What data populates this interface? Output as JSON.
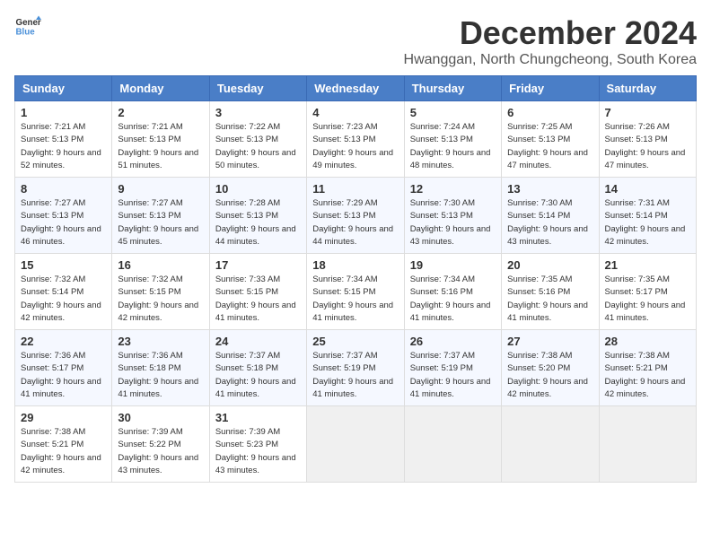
{
  "header": {
    "logo_line1": "General",
    "logo_line2": "Blue",
    "month_title": "December 2024",
    "location": "Hwanggan, North Chungcheong, South Korea"
  },
  "weekdays": [
    "Sunday",
    "Monday",
    "Tuesday",
    "Wednesday",
    "Thursday",
    "Friday",
    "Saturday"
  ],
  "weeks": [
    [
      {
        "day": "1",
        "sunrise": "Sunrise: 7:21 AM",
        "sunset": "Sunset: 5:13 PM",
        "daylight": "Daylight: 9 hours and 52 minutes."
      },
      {
        "day": "2",
        "sunrise": "Sunrise: 7:21 AM",
        "sunset": "Sunset: 5:13 PM",
        "daylight": "Daylight: 9 hours and 51 minutes."
      },
      {
        "day": "3",
        "sunrise": "Sunrise: 7:22 AM",
        "sunset": "Sunset: 5:13 PM",
        "daylight": "Daylight: 9 hours and 50 minutes."
      },
      {
        "day": "4",
        "sunrise": "Sunrise: 7:23 AM",
        "sunset": "Sunset: 5:13 PM",
        "daylight": "Daylight: 9 hours and 49 minutes."
      },
      {
        "day": "5",
        "sunrise": "Sunrise: 7:24 AM",
        "sunset": "Sunset: 5:13 PM",
        "daylight": "Daylight: 9 hours and 48 minutes."
      },
      {
        "day": "6",
        "sunrise": "Sunrise: 7:25 AM",
        "sunset": "Sunset: 5:13 PM",
        "daylight": "Daylight: 9 hours and 47 minutes."
      },
      {
        "day": "7",
        "sunrise": "Sunrise: 7:26 AM",
        "sunset": "Sunset: 5:13 PM",
        "daylight": "Daylight: 9 hours and 47 minutes."
      }
    ],
    [
      {
        "day": "8",
        "sunrise": "Sunrise: 7:27 AM",
        "sunset": "Sunset: 5:13 PM",
        "daylight": "Daylight: 9 hours and 46 minutes."
      },
      {
        "day": "9",
        "sunrise": "Sunrise: 7:27 AM",
        "sunset": "Sunset: 5:13 PM",
        "daylight": "Daylight: 9 hours and 45 minutes."
      },
      {
        "day": "10",
        "sunrise": "Sunrise: 7:28 AM",
        "sunset": "Sunset: 5:13 PM",
        "daylight": "Daylight: 9 hours and 44 minutes."
      },
      {
        "day": "11",
        "sunrise": "Sunrise: 7:29 AM",
        "sunset": "Sunset: 5:13 PM",
        "daylight": "Daylight: 9 hours and 44 minutes."
      },
      {
        "day": "12",
        "sunrise": "Sunrise: 7:30 AM",
        "sunset": "Sunset: 5:13 PM",
        "daylight": "Daylight: 9 hours and 43 minutes."
      },
      {
        "day": "13",
        "sunrise": "Sunrise: 7:30 AM",
        "sunset": "Sunset: 5:14 PM",
        "daylight": "Daylight: 9 hours and 43 minutes."
      },
      {
        "day": "14",
        "sunrise": "Sunrise: 7:31 AM",
        "sunset": "Sunset: 5:14 PM",
        "daylight": "Daylight: 9 hours and 42 minutes."
      }
    ],
    [
      {
        "day": "15",
        "sunrise": "Sunrise: 7:32 AM",
        "sunset": "Sunset: 5:14 PM",
        "daylight": "Daylight: 9 hours and 42 minutes."
      },
      {
        "day": "16",
        "sunrise": "Sunrise: 7:32 AM",
        "sunset": "Sunset: 5:15 PM",
        "daylight": "Daylight: 9 hours and 42 minutes."
      },
      {
        "day": "17",
        "sunrise": "Sunrise: 7:33 AM",
        "sunset": "Sunset: 5:15 PM",
        "daylight": "Daylight: 9 hours and 41 minutes."
      },
      {
        "day": "18",
        "sunrise": "Sunrise: 7:34 AM",
        "sunset": "Sunset: 5:15 PM",
        "daylight": "Daylight: 9 hours and 41 minutes."
      },
      {
        "day": "19",
        "sunrise": "Sunrise: 7:34 AM",
        "sunset": "Sunset: 5:16 PM",
        "daylight": "Daylight: 9 hours and 41 minutes."
      },
      {
        "day": "20",
        "sunrise": "Sunrise: 7:35 AM",
        "sunset": "Sunset: 5:16 PM",
        "daylight": "Daylight: 9 hours and 41 minutes."
      },
      {
        "day": "21",
        "sunrise": "Sunrise: 7:35 AM",
        "sunset": "Sunset: 5:17 PM",
        "daylight": "Daylight: 9 hours and 41 minutes."
      }
    ],
    [
      {
        "day": "22",
        "sunrise": "Sunrise: 7:36 AM",
        "sunset": "Sunset: 5:17 PM",
        "daylight": "Daylight: 9 hours and 41 minutes."
      },
      {
        "day": "23",
        "sunrise": "Sunrise: 7:36 AM",
        "sunset": "Sunset: 5:18 PM",
        "daylight": "Daylight: 9 hours and 41 minutes."
      },
      {
        "day": "24",
        "sunrise": "Sunrise: 7:37 AM",
        "sunset": "Sunset: 5:18 PM",
        "daylight": "Daylight: 9 hours and 41 minutes."
      },
      {
        "day": "25",
        "sunrise": "Sunrise: 7:37 AM",
        "sunset": "Sunset: 5:19 PM",
        "daylight": "Daylight: 9 hours and 41 minutes."
      },
      {
        "day": "26",
        "sunrise": "Sunrise: 7:37 AM",
        "sunset": "Sunset: 5:19 PM",
        "daylight": "Daylight: 9 hours and 41 minutes."
      },
      {
        "day": "27",
        "sunrise": "Sunrise: 7:38 AM",
        "sunset": "Sunset: 5:20 PM",
        "daylight": "Daylight: 9 hours and 42 minutes."
      },
      {
        "day": "28",
        "sunrise": "Sunrise: 7:38 AM",
        "sunset": "Sunset: 5:21 PM",
        "daylight": "Daylight: 9 hours and 42 minutes."
      }
    ],
    [
      {
        "day": "29",
        "sunrise": "Sunrise: 7:38 AM",
        "sunset": "Sunset: 5:21 PM",
        "daylight": "Daylight: 9 hours and 42 minutes."
      },
      {
        "day": "30",
        "sunrise": "Sunrise: 7:39 AM",
        "sunset": "Sunset: 5:22 PM",
        "daylight": "Daylight: 9 hours and 43 minutes."
      },
      {
        "day": "31",
        "sunrise": "Sunrise: 7:39 AM",
        "sunset": "Sunset: 5:23 PM",
        "daylight": "Daylight: 9 hours and 43 minutes."
      },
      null,
      null,
      null,
      null
    ]
  ]
}
